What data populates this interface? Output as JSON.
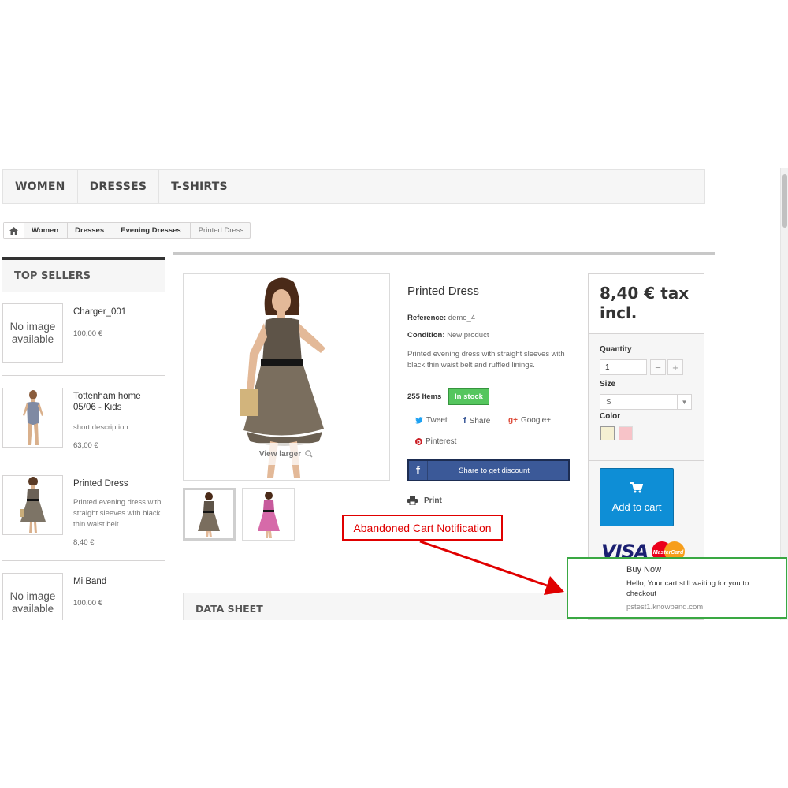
{
  "menu": [
    "WOMEN",
    "DRESSES",
    "T-SHIRTS"
  ],
  "breadcrumb": {
    "items": [
      "Women",
      "Dresses",
      "Evening Dresses"
    ],
    "current": "Printed Dress"
  },
  "top_sellers": {
    "title": "TOP SELLERS",
    "items": [
      {
        "name": "Charger_001",
        "image_text": "No image available",
        "desc": "",
        "price": "100,00 €"
      },
      {
        "name": "Tottenham home 05/06 - Kids",
        "image_text": "",
        "desc": "short description",
        "price": "63,00 €"
      },
      {
        "name": "Printed Dress",
        "image_text": "",
        "desc": "Printed evening dress with straight sleeves with black thin waist belt...",
        "price": "8,40 €"
      },
      {
        "name": "Mi Band",
        "image_text": "No image available",
        "desc": "",
        "price": "100,00 €"
      }
    ]
  },
  "product": {
    "view_larger": "View larger",
    "title": "Printed Dress",
    "reference_label": "Reference:",
    "reference": "demo_4",
    "condition_label": "Condition:",
    "condition": "New product",
    "description": "Printed evening dress with straight sleeves with black thin waist belt and ruffled linings.",
    "stock_count": "255 Items",
    "stock_status": "In stock",
    "social": {
      "tweet": "Tweet",
      "share": "Share",
      "google": "Google+",
      "pinterest": "Pinterest"
    },
    "fb_share": "Share to get discount",
    "print": "Print"
  },
  "buy_box": {
    "price": "8,40 € tax incl.",
    "quantity_label": "Quantity",
    "quantity": "1",
    "size_label": "Size",
    "size": "S",
    "color_label": "Color",
    "colors": [
      "#f5f0d2",
      "#f7c3c8"
    ],
    "add_to_cart": "Add to cart",
    "visa": "VISA",
    "mastercard": "MasterCard"
  },
  "data_sheet": "DATA SHEET",
  "annotation": {
    "label": "Abandoned Cart Notification"
  },
  "notification": {
    "title": "Buy Now",
    "body": "Hello, Your cart still waiting for you to checkout",
    "site": "pstest1.knowband.com"
  },
  "colors": {
    "in_stock": "#55c65e",
    "facebook": "#3b5998",
    "add_to_cart": "#0e8ed6",
    "annotation_red": "#e00000",
    "notification_green": "#3aa843"
  }
}
